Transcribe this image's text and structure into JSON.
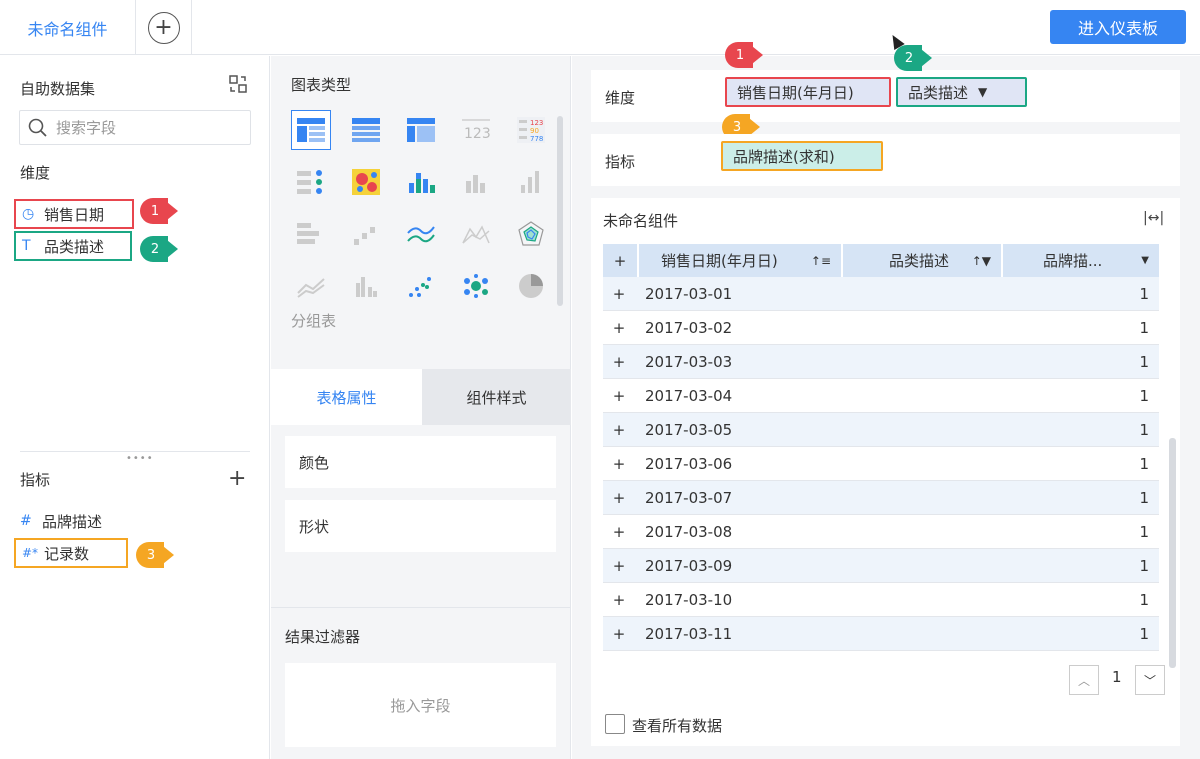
{
  "topbar": {
    "tab_label": "未命名组件",
    "add_tab": "+",
    "enter_dashboard": "进入仪表板"
  },
  "left": {
    "dataset_title": "自助数据集",
    "search_placeholder": "搜索字段",
    "dimension_label": "维度",
    "dimensions": [
      {
        "icon": "clock-icon",
        "glyph": "◷",
        "label": "销售日期"
      },
      {
        "icon": "text-icon",
        "glyph": "T",
        "label": "品类描述"
      }
    ],
    "metric_label": "指标",
    "metrics": [
      {
        "icon": "hash-icon",
        "glyph": "#",
        "label": "品牌描述"
      },
      {
        "icon": "hash-star-icon",
        "glyph": "#*",
        "label": "记录数"
      }
    ]
  },
  "middle": {
    "chart_type_title": "图表类型",
    "group_label": "分组表",
    "tab_table_props": "表格属性",
    "tab_component_style": "组件样式",
    "prop_color": "颜色",
    "prop_shape": "形状",
    "result_filter": "结果过滤器",
    "drop_hint": "拖入字段"
  },
  "right": {
    "dimension_label": "维度",
    "dimension_pills": [
      "销售日期(年月日)",
      "品类描述"
    ],
    "metric_label": "指标",
    "metric_pills": [
      "品牌描述(求和)"
    ],
    "widget_title": "未命名组件",
    "table": {
      "headers": [
        "销售日期(年月日)",
        "品类描述",
        "品牌描..."
      ],
      "rows": [
        [
          "2017-03-01",
          "",
          "1"
        ],
        [
          "2017-03-02",
          "",
          "1"
        ],
        [
          "2017-03-03",
          "",
          "1"
        ],
        [
          "2017-03-04",
          "",
          "1"
        ],
        [
          "2017-03-05",
          "",
          "1"
        ],
        [
          "2017-03-06",
          "",
          "1"
        ],
        [
          "2017-03-07",
          "",
          "1"
        ],
        [
          "2017-03-08",
          "",
          "1"
        ],
        [
          "2017-03-09",
          "",
          "1"
        ],
        [
          "2017-03-10",
          "",
          "1"
        ],
        [
          "2017-03-11",
          "",
          "1"
        ]
      ]
    },
    "page_number": "1",
    "view_all": "查看所有数据"
  },
  "markers": [
    "1",
    "2",
    "3",
    "1",
    "2",
    "3"
  ],
  "colors": {
    "accent": "#3685f2",
    "red": "#e8464e",
    "green": "#1ba784",
    "orange": "#f5a623"
  }
}
